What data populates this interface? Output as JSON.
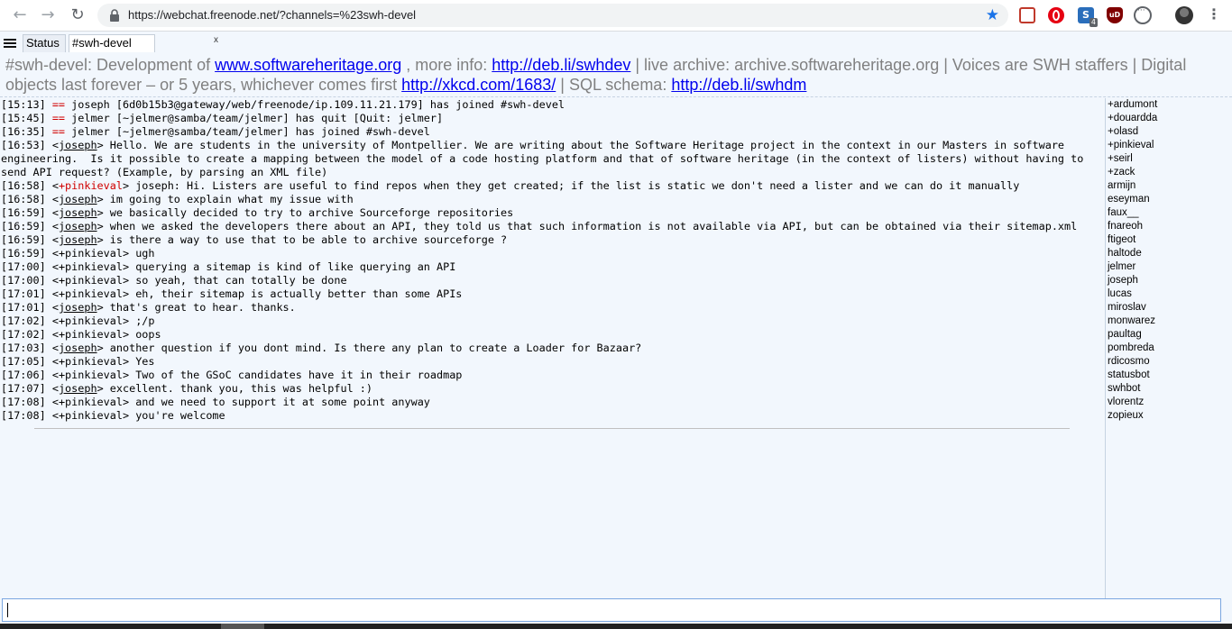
{
  "browser": {
    "url": "https://webchat.freenode.net/?channels=%23swh-devel",
    "ext_s_badge": "4",
    "ext_ublock_label": "uD",
    "ext_s_label": "S"
  },
  "tabs": [
    {
      "label": "Status"
    },
    {
      "label": "#swh-devel",
      "close": "x"
    }
  ],
  "topic": {
    "t1": "#swh-devel: Development of ",
    "link1": "www.softwareheritage.org",
    "t2": " , more info: ",
    "link2": "http://deb.li/swhdev",
    "t3": " | live archive: archive.softwareheritage.org | Voices are SWH staffers | Digital objects last forever – or 5 years, whichever comes first ",
    "link3": "http://xkcd.com/1683/",
    "t4": " | SQL schema: ",
    "link4": "http://deb.li/swhdm"
  },
  "messages": [
    {
      "time": "[15:13]",
      "type": "event",
      "marker": "==",
      "text": " joseph [6d0b15b3@gateway/web/freenode/ip.109.11.21.179] has joined #swh-devel"
    },
    {
      "time": "[15:45]",
      "type": "event",
      "marker": "==",
      "text": " jelmer [~jelmer@samba/team/jelmer] has quit [Quit: jelmer]"
    },
    {
      "time": "[16:35]",
      "type": "event",
      "marker": "==",
      "text": " jelmer [~jelmer@samba/team/jelmer] has joined #swh-devel"
    },
    {
      "time": "[16:53]",
      "type": "msg",
      "nick": "joseph",
      "text": "Hello. We are students in the university of Montpellier. We are writing about the Software Heritage project in the context in our Masters in software engineering.  Is it possible to create a mapping between the model of a code hosting platform and that of software heritage (in the context of listers) without having to send API request? (Example, by parsing an XML file)"
    },
    {
      "time": "[16:58]",
      "type": "hl",
      "nick": "+pinkieval",
      "text": "joseph: Hi. Listers are useful to find repos when they get created; if the list is static we don't need a lister and we can do it manually"
    },
    {
      "time": "[16:58]",
      "type": "msg",
      "nick": "joseph",
      "text": "im going to explain what my issue with"
    },
    {
      "time": "[16:59]",
      "type": "msg",
      "nick": "joseph",
      "text": "we basically decided to try to archive Sourceforge repositories"
    },
    {
      "time": "[16:59]",
      "type": "msg",
      "nick": "joseph",
      "text": "when we asked the developers there about an API, they told us that such information is not available via API, but can be obtained via their sitemap.xml"
    },
    {
      "time": "[16:59]",
      "type": "msg",
      "nick": "joseph",
      "text": "is there a way to use that to be able to archive sourceforge ?"
    },
    {
      "time": "[16:59]",
      "type": "msgp",
      "nick": "+pinkieval",
      "text": "ugh"
    },
    {
      "time": "[17:00]",
      "type": "msgp",
      "nick": "+pinkieval",
      "text": "querying a sitemap is kind of like querying an API"
    },
    {
      "time": "[17:00]",
      "type": "msgp",
      "nick": "+pinkieval",
      "text": "so yeah, that can totally be done"
    },
    {
      "time": "[17:01]",
      "type": "msgp",
      "nick": "+pinkieval",
      "text": "eh, their sitemap is actually better than some APIs"
    },
    {
      "time": "[17:01]",
      "type": "msg",
      "nick": "joseph",
      "text": "that's great to hear. thanks."
    },
    {
      "time": "[17:02]",
      "type": "msgp",
      "nick": "+pinkieval",
      "text": ";/p"
    },
    {
      "time": "[17:02]",
      "type": "msgp",
      "nick": "+pinkieval",
      "text": "oops"
    },
    {
      "time": "[17:03]",
      "type": "msg",
      "nick": "joseph",
      "text": "another question if you dont mind. Is there any plan to create a Loader for Bazaar?"
    },
    {
      "time": "[17:05]",
      "type": "msgp",
      "nick": "+pinkieval",
      "text": "Yes"
    },
    {
      "time": "[17:06]",
      "type": "msgp",
      "nick": "+pinkieval",
      "text": "Two of the GSoC candidates have it in their roadmap"
    },
    {
      "time": "[17:07]",
      "type": "msg",
      "nick": "joseph",
      "text": "excellent. thank you, this was helpful :)"
    },
    {
      "time": "[17:08]",
      "type": "msgp",
      "nick": "+pinkieval",
      "text": "and we need to support it at some point anyway"
    },
    {
      "time": "[17:08]",
      "type": "msgp",
      "nick": "+pinkieval",
      "text": "you're welcome"
    }
  ],
  "nicks": [
    "+ardumont",
    "+douardda",
    "+olasd",
    "+pinkieval",
    "+seirl",
    "+zack",
    "armijn",
    "eseyman",
    "faux__",
    "fnareoh",
    "ftigeot",
    "haltode",
    "jelmer",
    "joseph",
    "lucas",
    "miroslav",
    "monwarez",
    "paultag",
    "pombreda",
    "rdicosmo",
    "statusbot",
    "swhbot",
    "vlorentz",
    "zopieux"
  ],
  "input": {
    "value": ""
  }
}
